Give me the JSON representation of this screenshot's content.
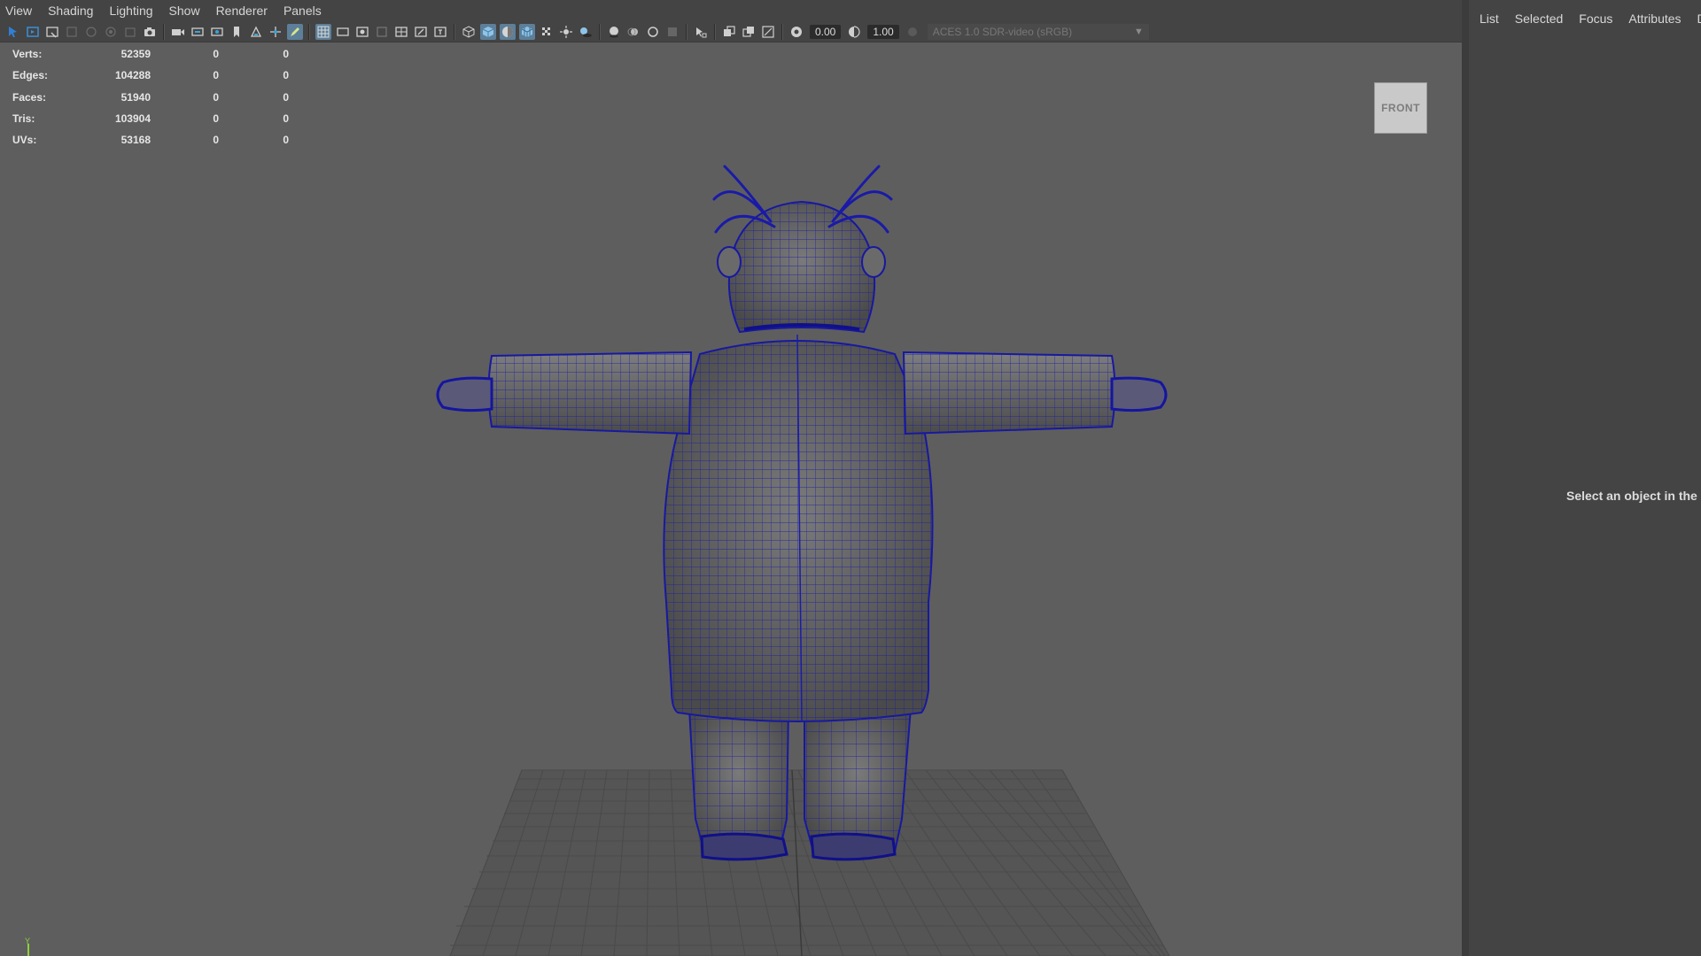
{
  "menu": [
    "View",
    "Shading",
    "Lighting",
    "Show",
    "Renderer",
    "Panels"
  ],
  "toolbar": {
    "exposure_value": "0.00",
    "gamma_value": "1.00",
    "color_space": "ACES 1.0 SDR-video (sRGB)"
  },
  "stats": [
    {
      "label": "Verts:",
      "value": "52359",
      "a": "0",
      "b": "0"
    },
    {
      "label": "Edges:",
      "value": "104288",
      "a": "0",
      "b": "0"
    },
    {
      "label": "Faces:",
      "value": "51940",
      "a": "0",
      "b": "0"
    },
    {
      "label": "Tris:",
      "value": "103904",
      "a": "0",
      "b": "0"
    },
    {
      "label": "UVs:",
      "value": "53168",
      "a": "0",
      "b": "0"
    }
  ],
  "viewcube_label": "FRONT",
  "axis_label": "Y",
  "outliner": {
    "tabs": [
      "List",
      "Selected",
      "Focus",
      "Attributes",
      "D"
    ],
    "message": "Select an object in the sc"
  },
  "colors": {
    "wireframe": "#1a1aa8",
    "model_shade": "#6d6d6d",
    "viewport_bg": "#5e5e5e",
    "ui_bg": "#444444",
    "active_button": "#5d7f99"
  }
}
